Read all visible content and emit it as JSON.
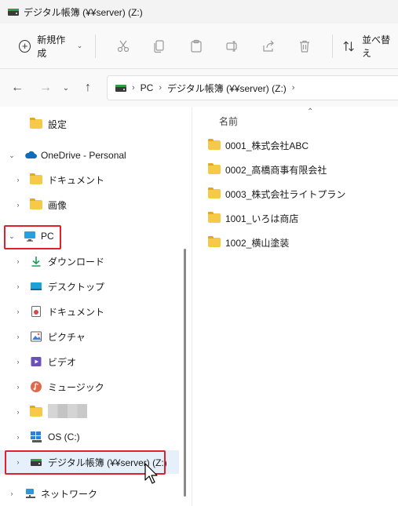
{
  "window": {
    "title": "デジタル帳簿 (¥¥server) (Z:)"
  },
  "toolbar": {
    "new_label": "新規作成",
    "sort_label": "並べ替え",
    "icons": [
      "cut-icon",
      "copy-icon",
      "paste-icon",
      "rename-icon",
      "share-icon",
      "delete-icon"
    ]
  },
  "address": {
    "crumbs": [
      "PC",
      "デジタル帳簿 (¥¥server) (Z:)"
    ]
  },
  "sidebar": {
    "items": [
      {
        "label": "設定",
        "icon": "folder-icon"
      },
      {
        "label": "OneDrive - Personal",
        "icon": "cloud-icon"
      },
      {
        "label": "ドキュメント",
        "icon": "folder-icon"
      },
      {
        "label": "画像",
        "icon": "folder-icon"
      },
      {
        "label": "PC",
        "icon": "monitor-icon"
      },
      {
        "label": "ダウンロード",
        "icon": "download-icon"
      },
      {
        "label": "デスクトップ",
        "icon": "desktop-icon"
      },
      {
        "label": "ドキュメント",
        "icon": "documents-icon"
      },
      {
        "label": "ピクチャ",
        "icon": "pictures-icon"
      },
      {
        "label": "ビデオ",
        "icon": "videos-icon"
      },
      {
        "label": "ミュージック",
        "icon": "music-icon"
      },
      {
        "label": "",
        "icon": "folder-icon"
      },
      {
        "label": "OS (C:)",
        "icon": "windows-drive-icon"
      },
      {
        "label": "デジタル帳簿 (¥¥server) (Z:)",
        "icon": "network-drive-icon"
      },
      {
        "label": "ネットワーク",
        "icon": "network-icon"
      }
    ]
  },
  "content": {
    "column_name": "名前",
    "files": [
      "0001_株式会社ABC",
      "0002_高橋商事有限会社",
      "0003_株式会社ライトプラン",
      "1001_いろは商店",
      "1002_横山塗装"
    ]
  },
  "colors": {
    "folder": "#f7c948",
    "highlight": "#e0202a",
    "selection": "#e5f0fb"
  }
}
